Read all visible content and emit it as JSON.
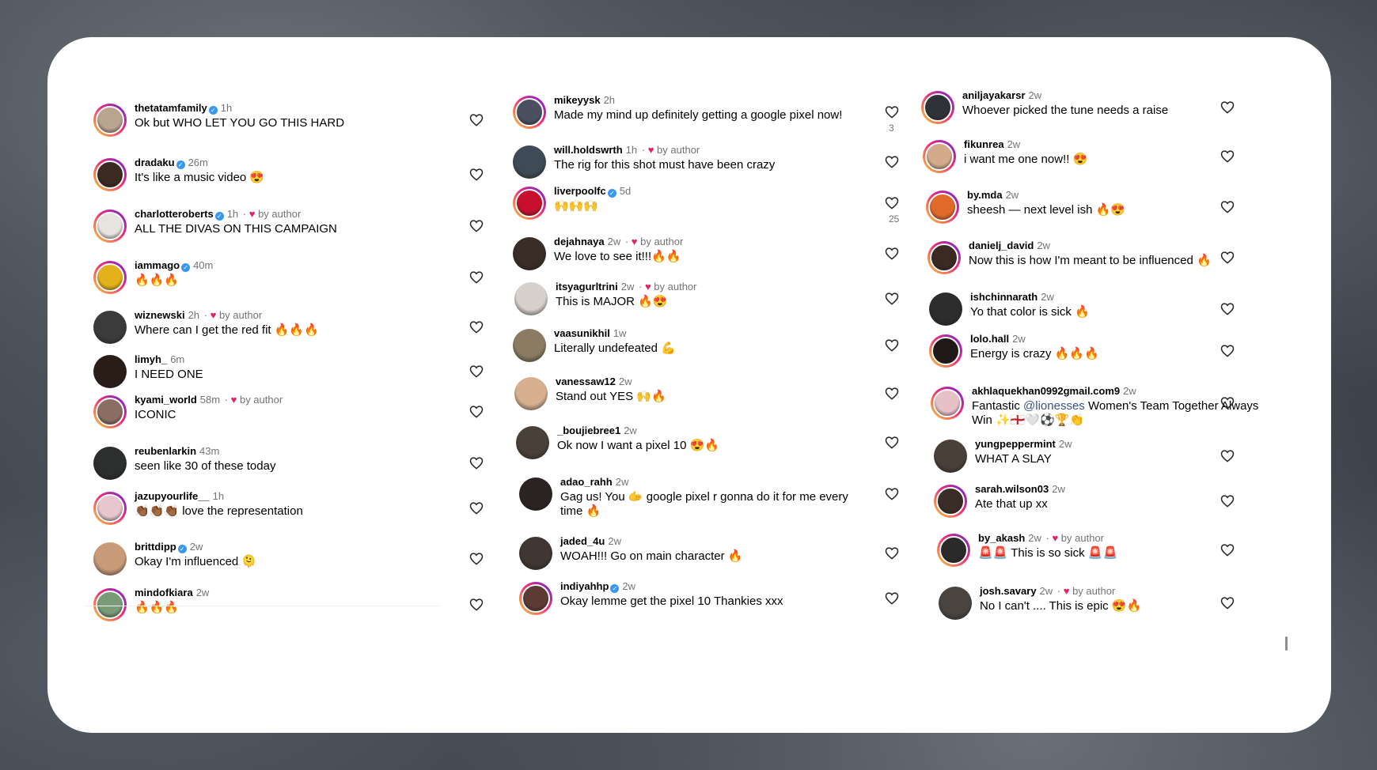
{
  "columns": [
    {
      "comments": [
        {
          "user": "thetatamfamily",
          "verified": true,
          "ago": "1h",
          "by_author": false,
          "text": "Ok but WHO LET YOU GO THIS HARD",
          "avatar": "#b9a48f",
          "ring": true
        },
        {
          "user": "dradaku",
          "verified": true,
          "ago": "26m",
          "by_author": false,
          "text": "It's like a music video 😍",
          "avatar": "#3a2a22",
          "ring": true
        },
        {
          "user": "charlotteroberts",
          "verified": true,
          "ago": "1h",
          "by_author": true,
          "text": "ALL THE DIVAS ON THIS CAMPAIGN",
          "avatar": "#e7e3df",
          "ring": true
        },
        {
          "user": "iammago",
          "verified": true,
          "ago": "40m",
          "by_author": false,
          "text": "🔥🔥🔥",
          "avatar": "#e3b21a",
          "ring": true
        },
        {
          "user": "wiznewski",
          "verified": false,
          "ago": "2h",
          "by_author": true,
          "text": "Where can I get the red fit 🔥🔥🔥",
          "avatar": "#3b3b3b",
          "ring": false
        },
        {
          "user": "limyh_",
          "verified": false,
          "ago": "6m",
          "by_author": false,
          "text": "I NEED ONE",
          "avatar": "#2a1d18",
          "ring": false
        },
        {
          "user": "kyami_world",
          "verified": false,
          "ago": "58m",
          "by_author": true,
          "text": "ICONIC",
          "avatar": "#8a6e61",
          "ring": true
        },
        {
          "user": "reubenlarkin",
          "verified": false,
          "ago": "43m",
          "by_author": false,
          "text": "seen like 30 of these today",
          "avatar": "#2c2f2e",
          "ring": false
        },
        {
          "user": "jazupyourlife__",
          "verified": false,
          "ago": "1h",
          "by_author": false,
          "text": "👏🏾👏🏾👏🏾 love the representation",
          "avatar": "#e7c6cf",
          "ring": true
        },
        {
          "user": "brittdipp",
          "verified": true,
          "ago": "2w",
          "by_author": false,
          "text": "Okay I'm influenced 🫠",
          "avatar": "#c89a78",
          "ring": false
        },
        {
          "user": "mindofkiara",
          "verified": false,
          "ago": "2w",
          "by_author": false,
          "text": "🔥🔥🔥",
          "avatar": "#7a9b77",
          "ring": true
        }
      ]
    },
    {
      "comments": [
        {
          "user": "mikeyysk",
          "verified": false,
          "ago": "2h",
          "by_author": false,
          "text": "Made my mind up definitely getting a google pixel now!",
          "avatar": "#4b5060",
          "ring": true,
          "likes": "3"
        },
        {
          "user": "will.holdswrth",
          "verified": false,
          "ago": "1h",
          "by_author": true,
          "text": "The rig for this shot must have been crazy",
          "avatar": "#3e4a55",
          "ring": false
        },
        {
          "user": "liverpoolfc",
          "verified": true,
          "ago": "5d",
          "by_author": false,
          "text": "🙌🙌🙌",
          "avatar": "#c8102e",
          "ring": true,
          "likes": "25"
        },
        {
          "user": "dejahnaya",
          "verified": false,
          "ago": "2w",
          "by_author": true,
          "text": "We love to see it!!!🔥🔥",
          "avatar": "#3a2c26",
          "ring": false
        },
        {
          "user": "itsyagurltrini",
          "verified": false,
          "ago": "2w",
          "by_author": true,
          "text": "This is MAJOR 🔥😍",
          "avatar": "#d7d0cc",
          "ring": false
        },
        {
          "user": "vaasunikhil",
          "verified": false,
          "ago": "1w",
          "by_author": false,
          "text": "Literally undefeated 💪",
          "avatar": "#8a7b62",
          "ring": false
        },
        {
          "user": "vanessaw12",
          "verified": false,
          "ago": "2w",
          "by_author": false,
          "text": "Stand out YES 🙌🔥",
          "avatar": "#d7b08f",
          "ring": false
        },
        {
          "user": "_boujiebree1",
          "verified": false,
          "ago": "2w",
          "by_author": false,
          "text": "Ok now I want a pixel 10 😍🔥",
          "avatar": "#4b4039",
          "ring": false
        },
        {
          "user": "adao_rahh",
          "verified": false,
          "ago": "2w",
          "by_author": false,
          "text": "Gag us! You 🫱 google pixel r gonna do it for me every time 🔥",
          "avatar": "#2b2321",
          "ring": false
        },
        {
          "user": "jaded_4u",
          "verified": false,
          "ago": "2w",
          "by_author": false,
          "text": "WOAH!!! Go on main character 🔥",
          "avatar": "#403632",
          "ring": false
        },
        {
          "user": "indiyahhp",
          "verified": true,
          "ago": "2w",
          "by_author": false,
          "text": "Okay lemme get the pixel 10 Thankies xxx",
          "avatar": "#5c3b35",
          "ring": true
        }
      ]
    },
    {
      "comments": [
        {
          "user": "aniljayakarsr",
          "verified": false,
          "ago": "2w",
          "by_author": false,
          "text": "Whoever picked the tune needs a raise",
          "avatar": "#2f3338",
          "ring": true
        },
        {
          "user": "fikunrea",
          "verified": false,
          "ago": "2w",
          "by_author": false,
          "text": "i want me one now!! 😍",
          "avatar": "#d3ab8c",
          "ring": true
        },
        {
          "user": "by.mda",
          "verified": false,
          "ago": "2w",
          "by_author": false,
          "text": "sheesh — next level ish 🔥😍",
          "avatar": "#e06a2a",
          "ring": true
        },
        {
          "user": "danielj_david",
          "verified": false,
          "ago": "2w",
          "by_author": false,
          "text": "Now this is how I'm meant to be influenced 🔥",
          "avatar": "#3a2a22",
          "ring": true
        },
        {
          "user": "ishchinnarath",
          "verified": false,
          "ago": "2w",
          "by_author": false,
          "text": "Yo that color is sick 🔥",
          "avatar": "#2d2d2d",
          "ring": false
        },
        {
          "user": "lolo.hall",
          "verified": false,
          "ago": "2w",
          "by_author": false,
          "text": "Energy is crazy 🔥🔥🔥",
          "avatar": "#1f1a18",
          "ring": true
        },
        {
          "user": "akhlaquekhan0992gmail.com9",
          "verified": false,
          "ago": "2w",
          "by_author": false,
          "text": "Fantastic @lionesses Women's Team Together Always Win ✨🏴󠁧󠁢󠁥󠁮󠁧󠁿🤍⚽🏆👏",
          "avatar": "#e6c2c7",
          "ring": true
        },
        {
          "user": "yungpeppermint",
          "verified": false,
          "ago": "2w",
          "by_author": false,
          "text": "WHAT A SLAY",
          "avatar": "#4b3f3a",
          "ring": false
        },
        {
          "user": "sarah.wilson03",
          "verified": false,
          "ago": "2w",
          "by_author": false,
          "text": "Ate that up xx",
          "avatar": "#3a2d28",
          "ring": true
        },
        {
          "user": "by_akash",
          "verified": false,
          "ago": "2w",
          "by_author": true,
          "text": "🚨🚨 This is so sick 🚨🚨",
          "avatar": "#2a2a2a",
          "ring": true
        },
        {
          "user": "josh.savary",
          "verified": false,
          "ago": "2w",
          "by_author": true,
          "text": "No I can't .... This is epic 😍🔥",
          "avatar": "#4a4440",
          "ring": false
        }
      ]
    }
  ],
  "by_author_label": "by author",
  "like_icon": "heart-outline-icon",
  "mention_color": "#385185",
  "verified_color": "#3897f0",
  "author_heart_color": "#e0245e"
}
